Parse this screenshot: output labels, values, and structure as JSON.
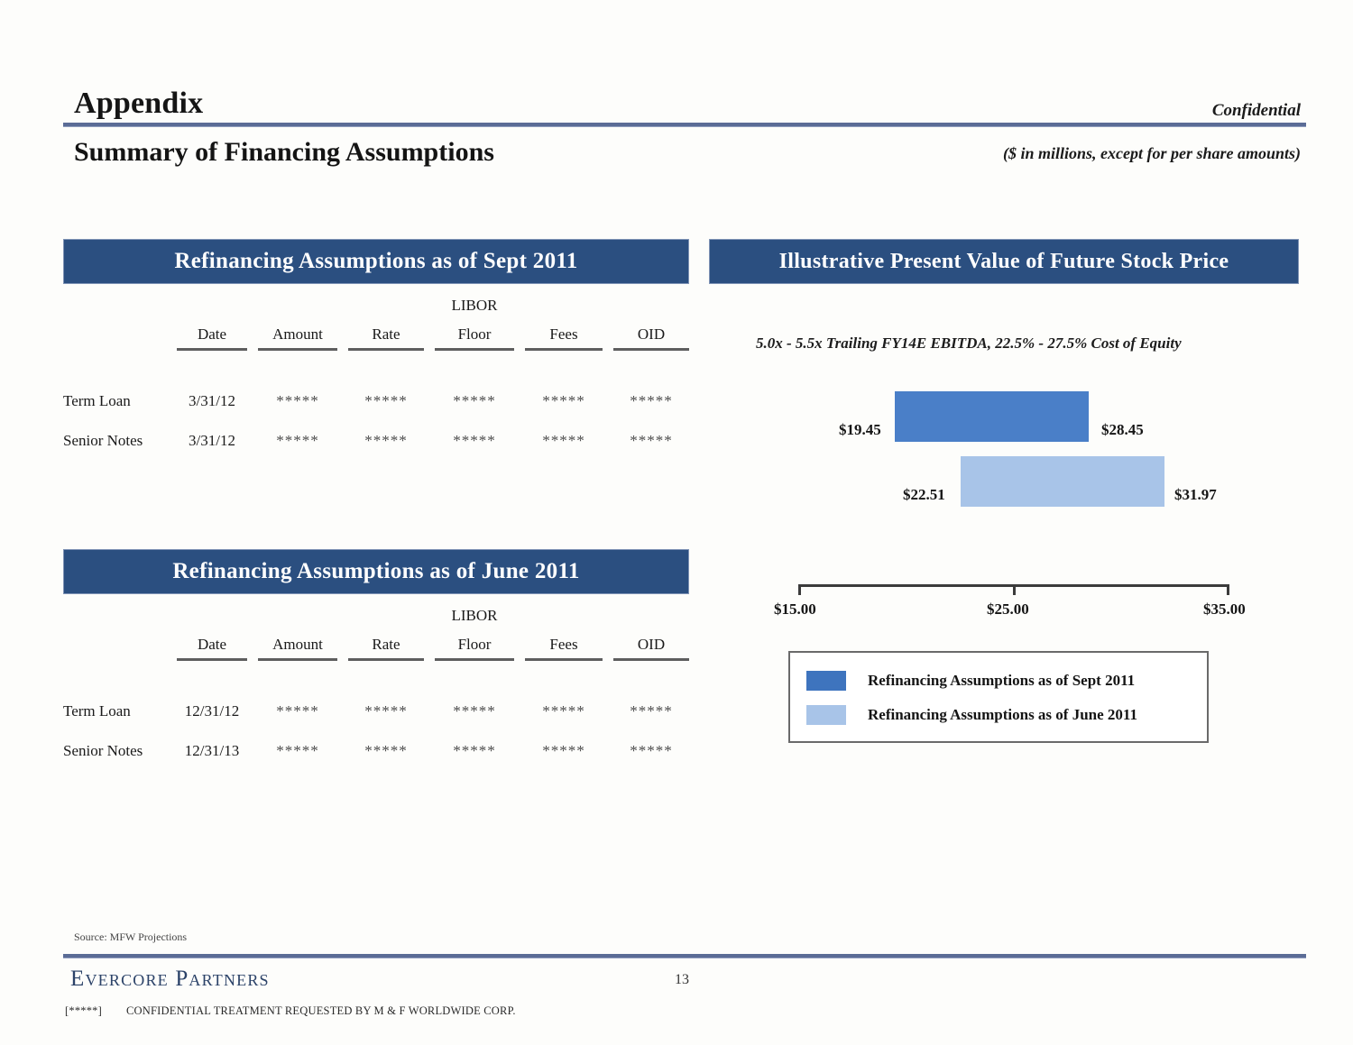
{
  "header": {
    "appendix_title": "Appendix",
    "confidential_label": "Confidential",
    "slide_title": "Summary of Financing Assumptions",
    "units_note": "($ in millions, except for per share amounts)"
  },
  "sections": {
    "sept_banner": "Refinancing Assumptions as of Sept 2011",
    "june_banner": "Refinancing Assumptions as of June 2011",
    "chart_banner": "Illustrative Present Value of Future Stock Price"
  },
  "table_sept": {
    "group_header": "LIBOR",
    "columns": [
      "Date",
      "Amount",
      "Rate",
      "Floor",
      "Fees",
      "OID"
    ],
    "rows": [
      {
        "label": "Term Loan",
        "date": "3/31/12",
        "amount": "*****",
        "rate": "*****",
        "floor": "*****",
        "fees": "*****",
        "oid": "*****"
      },
      {
        "label": "Senior Notes",
        "date": "3/31/12",
        "amount": "*****",
        "rate": "*****",
        "floor": "*****",
        "fees": "*****",
        "oid": "*****"
      }
    ]
  },
  "table_june": {
    "group_header": "LIBOR",
    "columns": [
      "Date",
      "Amount",
      "Rate",
      "Floor",
      "Fees",
      "OID"
    ],
    "rows": [
      {
        "label": "Term Loan",
        "date": "12/31/12",
        "amount": "*****",
        "rate": "*****",
        "floor": "*****",
        "fees": "*****",
        "oid": "*****"
      },
      {
        "label": "Senior Notes",
        "date": "12/31/13",
        "amount": "*****",
        "rate": "*****",
        "floor": "*****",
        "fees": "*****",
        "oid": "*****"
      }
    ]
  },
  "chart_data": {
    "type": "bar",
    "orientation": "horizontal",
    "subtype": "range-bar",
    "title": "Illustrative Present Value of Future Stock Price",
    "subtitle": "5.0x - 5.5x Trailing FY14E EBITDA, 22.5% - 27.5% Cost of Equity",
    "xlabel": "",
    "ylabel": "",
    "xlim": [
      15.0,
      35.0
    ],
    "tick_labels": [
      "$15.00",
      "$25.00",
      "$35.00"
    ],
    "tick_values": [
      15.0,
      25.0,
      35.0
    ],
    "grid": false,
    "legend_position": "bottom",
    "series": [
      {
        "name": "Refinancing Assumptions as of Sept 2011",
        "low": 19.45,
        "high": 28.45,
        "low_label": "$19.45",
        "high_label": "$28.45",
        "color": "#4A7FC8"
      },
      {
        "name": "Refinancing Assumptions as of June 2011",
        "low": 22.51,
        "high": 31.97,
        "low_label": "$22.51",
        "high_label": "$31.97",
        "color": "#A8C4E8"
      }
    ]
  },
  "legend": {
    "items": [
      {
        "label": "Refinancing Assumptions as of Sept 2011",
        "color": "#3E74BE"
      },
      {
        "label": "Refinancing Assumptions as of June 2011",
        "color": "#A8C4E8"
      }
    ]
  },
  "footer": {
    "source": "Source: MFW Projections",
    "brand": "Evercore Partners",
    "page_number": "13",
    "legal_tag": "[*****]",
    "legal_text": "CONFIDENTIAL TREATMENT REQUESTED BY M & F WORLDWIDE CORP."
  },
  "colors": {
    "banner_blue": "#2b4f80",
    "rule_blue": "#5b6c96",
    "brand_blue": "#2b4268",
    "series_dark": "#4A7FC8",
    "series_light": "#A8C4E8"
  }
}
